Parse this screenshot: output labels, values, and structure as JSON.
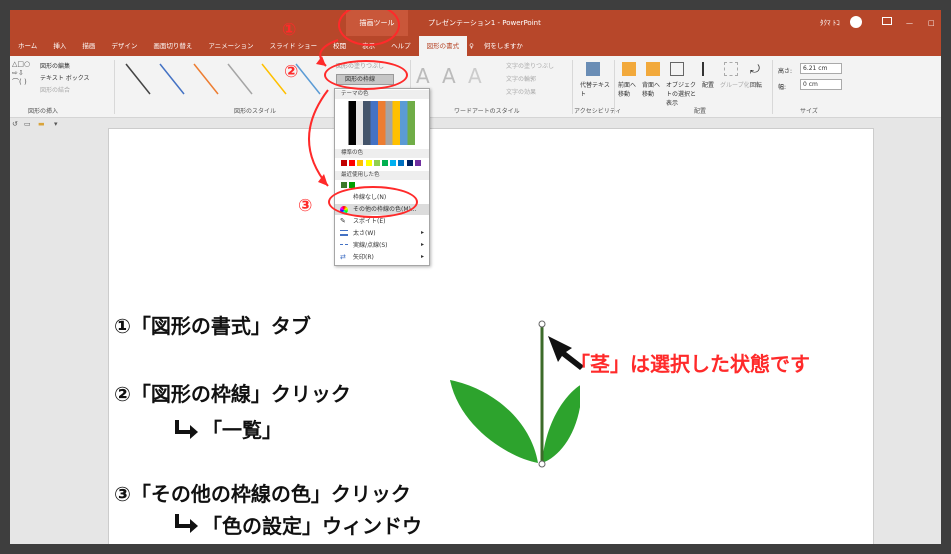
{
  "window": {
    "app_title": "プレゼンテーション1 - PowerPoint",
    "context_group": "描画ツール",
    "user": "ﾀｸﾏ ﾄｺ",
    "min_label": "—",
    "max_label": "□"
  },
  "tabs": [
    "ホーム",
    "挿入",
    "描画",
    "デザイン",
    "画面切り替え",
    "アニメーション",
    "スライド ショー",
    "校閲",
    "表示",
    "ヘルプ",
    "図形の書式"
  ],
  "tell_me": "何をしますか",
  "ribbon": {
    "insert_group": {
      "label": "図形の挿入",
      "edit_shape": "図形の編集",
      "textbox": "テキスト ボックス",
      "merge": "図形の結合"
    },
    "style_group": {
      "label": "図形のスタイル"
    },
    "fill_label": "図形の塗りつぶし",
    "outline_label": "図形の枠線",
    "effect_label": "効果",
    "wordart_group": {
      "label": "ワードアートのスタイル",
      "text_fill": "文字の塗りつぶし",
      "text_outline": "文字の輪郭",
      "text_effect": "文字の効果"
    },
    "accessibility": {
      "label": "アクセシビリティ",
      "alt_text": "代替テキスト"
    },
    "arrange_group": {
      "label": "配置",
      "forward": "前面へ移動",
      "backward": "背面へ移動",
      "selection_pane": "オブジェクトの選択と表示",
      "align": "配置",
      "group": "グループ化",
      "rotate": "回転"
    },
    "size_group": {
      "label": "サイズ",
      "height_label": "高さ:",
      "height_value": "6.21 cm",
      "width_label": "幅:",
      "width_value": "0 cm"
    }
  },
  "dropdown": {
    "theme_colors": "テーマの色",
    "standard_colors": "標準の色",
    "recent_colors": "最近使用した色",
    "no_outline": "枠線なし(N)",
    "more_colors": "その他の枠線の色(M)...",
    "eyedropper": "スポイト(E)",
    "weight": "太さ(W)",
    "dashes": "実線/点線(S)",
    "arrows": "矢印(R)",
    "standard_palette": [
      "#c00000",
      "#ff0000",
      "#ffc000",
      "#ffff00",
      "#92d050",
      "#00b050",
      "#00b0f0",
      "#0070c0",
      "#002060",
      "#7030a0"
    ],
    "recent_palette": [
      "#3b7a2a",
      "#00a000"
    ]
  },
  "annotations": {
    "n1": "①",
    "n2": "②",
    "n3": "③",
    "step1": "①「図形の書式」タブ",
    "step2": "②「図形の枠線」クリック",
    "step2b": "「一覧」",
    "step3": "③「その他の枠線の色」クリック",
    "step3b": "「色の設定」ウィンドウ",
    "stem_note": "「茎」は選択した状態です",
    "accent": "#ff2a2a"
  }
}
